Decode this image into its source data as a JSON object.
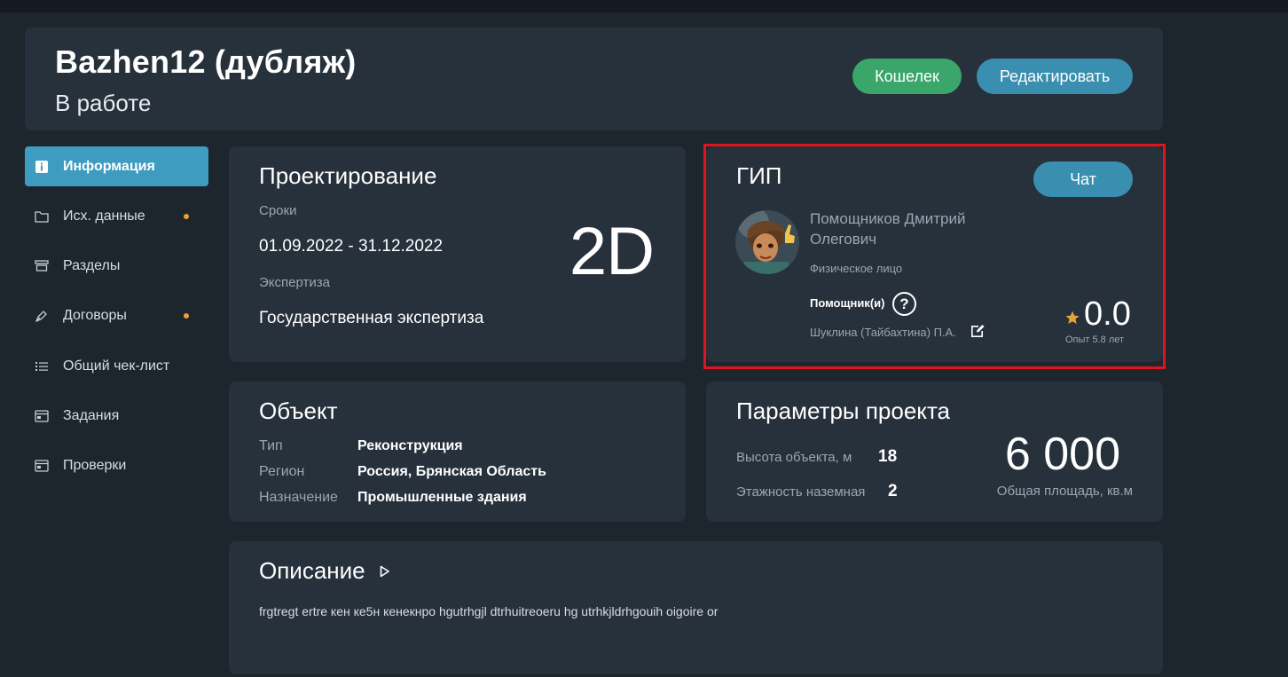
{
  "header": {
    "title": "Bazhen12 (дубляж)",
    "status": "В работе",
    "wallet_label": "Кошелек",
    "edit_label": "Редактировать"
  },
  "sidebar": {
    "items": [
      {
        "label": "Информация",
        "icon": "info-icon",
        "active": true,
        "dot": false
      },
      {
        "label": "Исх. данные",
        "icon": "folder-icon",
        "active": false,
        "dot": true
      },
      {
        "label": "Разделы",
        "icon": "sections-icon",
        "active": false,
        "dot": false
      },
      {
        "label": "Договоры",
        "icon": "pen-icon",
        "active": false,
        "dot": true
      },
      {
        "label": "Общий чек-лист",
        "icon": "checklist-icon",
        "active": false,
        "dot": false
      },
      {
        "label": "Задания",
        "icon": "tasks-icon",
        "active": false,
        "dot": false
      },
      {
        "label": "Проверки",
        "icon": "checks-icon",
        "active": false,
        "dot": false
      }
    ]
  },
  "design": {
    "title": "Проектирование",
    "dates_label": "Сроки",
    "dates_value": "01.09.2022 - 31.12.2022",
    "expertise_label": "Экспертиза",
    "expertise_value": "Государственная экспертиза",
    "type": "2D"
  },
  "gip": {
    "title": "ГИП",
    "chat_label": "Чат",
    "name": "Помощников Дмитрий Олегович",
    "kind": "Физическое лицо",
    "assistants_label": "Помощник(и)",
    "help_symbol": "?",
    "assistant_name": "Шуклина (Тайбахтина) П.А.",
    "rating": "0.0",
    "experience": "Опыт 5.8 лет"
  },
  "object": {
    "title": "Объект",
    "rows": [
      {
        "label": "Тип",
        "value": "Реконструкция"
      },
      {
        "label": "Регион",
        "value": "Россия, Брянская Область"
      },
      {
        "label": "Назначение",
        "value": "Промышленные здания"
      }
    ]
  },
  "params": {
    "title": "Параметры проекта",
    "height_label": "Высота объекта, м",
    "height_value": "18",
    "floors_label": "Этажность наземная",
    "floors_value": "2",
    "area_value": "6 000",
    "area_label": "Общая площадь, кв.м"
  },
  "description": {
    "title": "Описание",
    "text": "frgtregt ertre кен ке5н кенекнро hgutrhgjl dtrhuitreoeru hg utrhkjldrhgouih oigoire or"
  },
  "colors": {
    "background": "#1d252d",
    "card": "#27313c",
    "accent": "#3d9cc0",
    "wallet": "#3aa66a",
    "dot": "#e8a23a",
    "highlight": "#e0141e",
    "star": "#e8a23a"
  }
}
